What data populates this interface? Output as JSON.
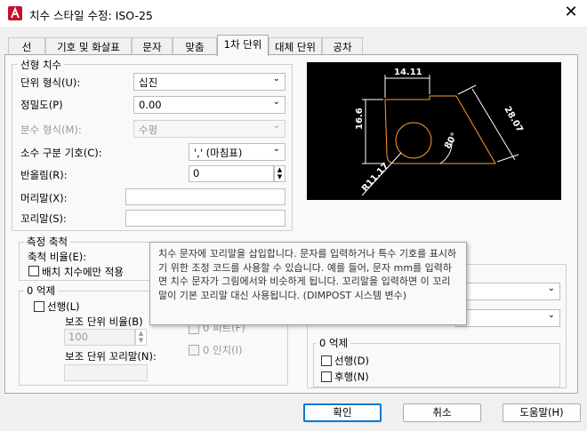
{
  "window": {
    "title": "치수 스타일 수정: ISO-25",
    "close": "✕"
  },
  "tabs": [
    "선",
    "기호 및 화살표",
    "문자",
    "맞춤",
    "1차 단위",
    "대체 단위",
    "공차"
  ],
  "linear": {
    "group_title": "선형 치수",
    "unit_format_label": "단위 형식(U):",
    "unit_format_value": "십진",
    "precision_label": "정밀도(P)",
    "precision_value": "0.00",
    "fraction_label": "분수 형식(M):",
    "fraction_value": "수평",
    "decimal_sep_label": "소수 구분 기호(C):",
    "decimal_sep_value": "','  (마침표)",
    "roundoff_label": "반올림(R):",
    "roundoff_value": "0",
    "prefix_label": "머리말(X):",
    "prefix_value": "",
    "suffix_label": "꼬리말(S):",
    "suffix_value": ""
  },
  "scale": {
    "group_title": "측정 축척",
    "factor_label": "축척 비율(E):",
    "layout_only_label": "배치 치수에만 적용"
  },
  "zero_left": {
    "group_title": "0 억제",
    "leading_label": "선행(L)",
    "sub_factor_label": "보조 단위 비율(B)",
    "sub_factor_value": "100",
    "sub_suffix_label": "보조 단위 꼬리말(N):",
    "feet_label": "0 피트(F)",
    "inches_label": "0 인치(I)"
  },
  "zero_right": {
    "group_title": "0 억제",
    "leading_label": "선행(D)",
    "trailing_label": "후행(N)"
  },
  "preview": {
    "dim_top": "14.11",
    "dim_left": "16.6",
    "dim_right": "28.07",
    "angle": "80°",
    "radius": "R11.17"
  },
  "tooltip": "치수 문자에 꼬리말을 삽입합니다. 문자를 입력하거나 특수 기호를 표시하기 위한 조정 코드를 사용할 수 있습니다. 예를 들어, 문자 mm를 입력하면 치수 문자가 그림에서와 비슷하게 됩니다. 꼬리말을 입력하면 이 꼬리말이 기본 꼬리말 대신 사용됩니다. (DIMPOST 시스템 변수)",
  "buttons": {
    "ok": "확인",
    "cancel": "취소",
    "help": "도움말(H)"
  },
  "colors": {
    "accent": "#0078d4",
    "app_icon": "#c8102e",
    "geometry": "#ff9b2f",
    "dims": "#ffffff"
  }
}
